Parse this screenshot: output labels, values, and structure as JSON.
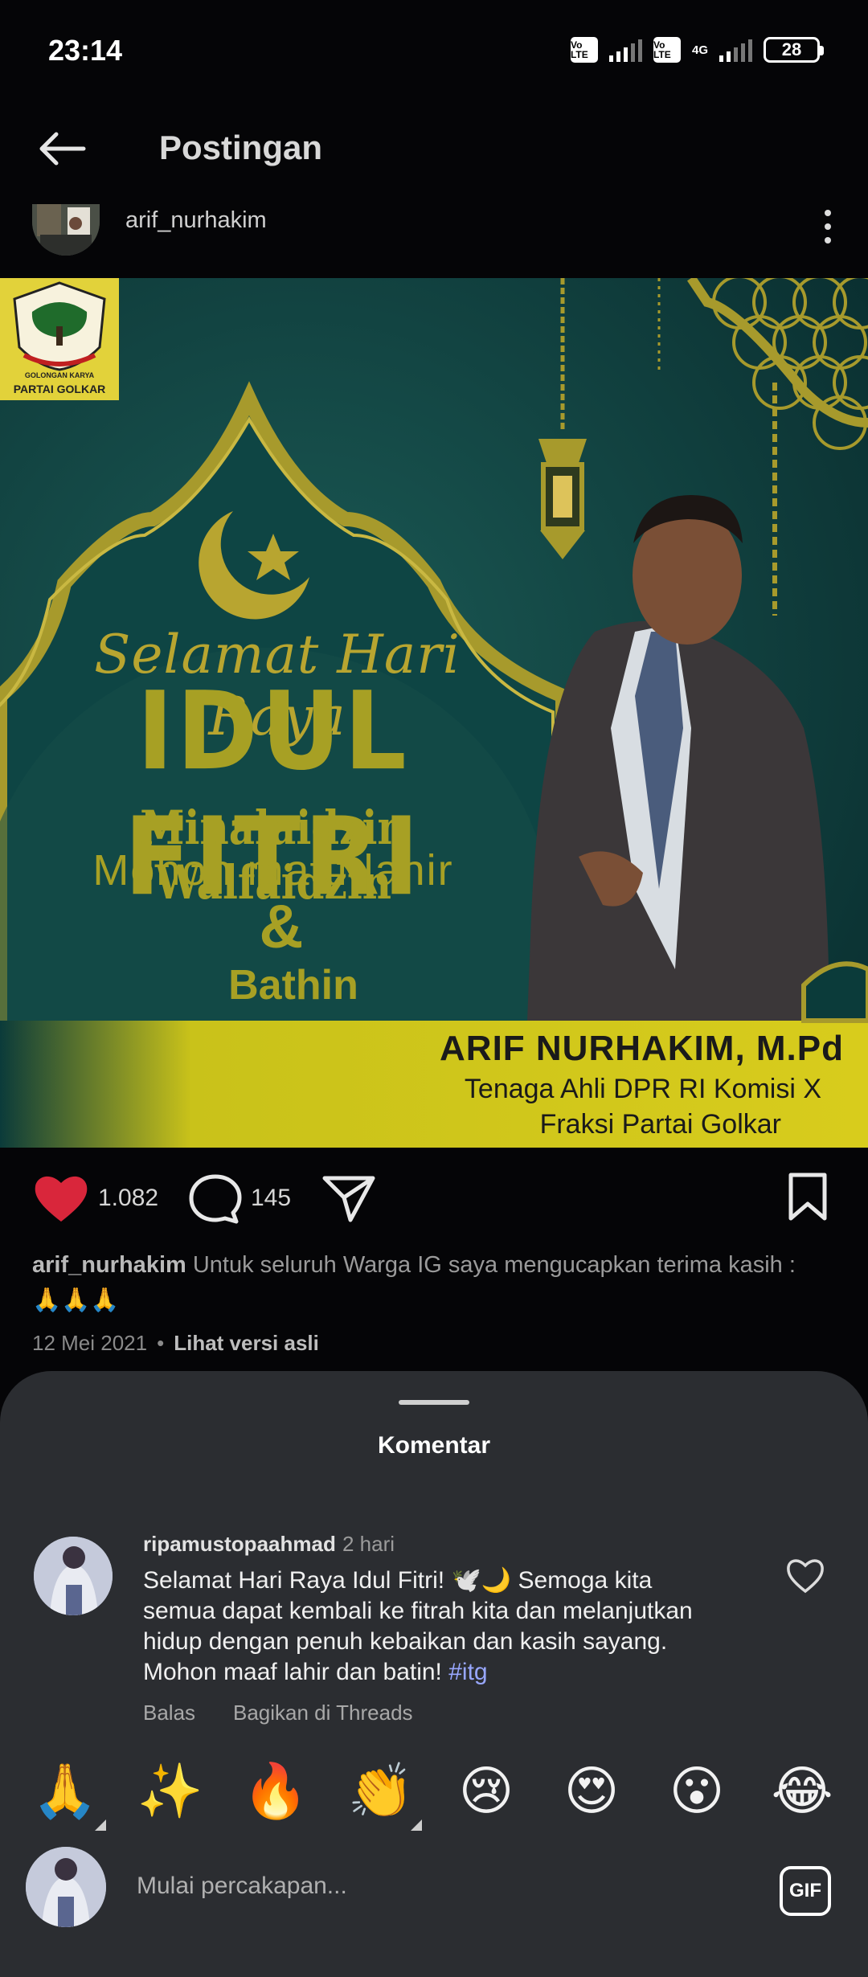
{
  "status_bar": {
    "time": "23:14",
    "volte1": "Vo LTE",
    "volte2": "Vo LTE",
    "network": "4G",
    "battery": "28"
  },
  "header": {
    "back_icon": "arrow-left-icon",
    "title": "Postingan"
  },
  "post": {
    "author": "arif_nurhakim",
    "image": {
      "logo_line1": "GOLONGAN KARYA",
      "logo_line2": "PARTAI GOLKAR",
      "greeting": "Selamat Hari Raya",
      "headline": "IDUL FITRI",
      "line1": "Minalaidzin Walfaidzin",
      "line2": "Mohon maaf lahir",
      "ampersand": "&",
      "line3": "Bathin",
      "name": "ARIF NURHAKIM, M.Pd",
      "role1": "Tenaga Ahli DPR RI Komisi X",
      "role2": "Fraksi Partai Golkar",
      "colors": {
        "background": "#0b3b3a",
        "gold": "#a7a024",
        "banner": "#d8cc1c"
      }
    },
    "likes": "1.082",
    "comments": "145",
    "caption_user": "arif_nurhakim",
    "caption_text": "Untuk seluruh Warga IG saya mengucapkan terima kasih :",
    "caption_emoji": "🙏🙏🙏",
    "date": "12 Mei 2021",
    "separator": "•",
    "see_original": "Lihat versi asli"
  },
  "comments_sheet": {
    "title": "Komentar",
    "comment": {
      "user": "ripamustopaahmad",
      "time": "2 hari",
      "text": "Selamat Hari Raya Idul Fitri! 🕊️🌙 Semoga kita semua dapat kembali ke fitrah kita dan melanjutkan hidup dengan penuh kebaikan dan kasih sayang. Mohon maaf lahir dan batin! ",
      "hashtag": "#itg",
      "reply": "Balas",
      "share_threads": "Bagikan di Threads"
    },
    "emojis": [
      "🙏",
      "✨",
      "🔥",
      "👏",
      "😢",
      "😍",
      "😮",
      "😂"
    ],
    "composer_placeholder": "Mulai percakapan...",
    "gif_label": "GIF"
  },
  "colors": {
    "like_red": "#d9263b",
    "hashtag": "#98a7ff",
    "sheet_bg": "#2b2d31"
  }
}
